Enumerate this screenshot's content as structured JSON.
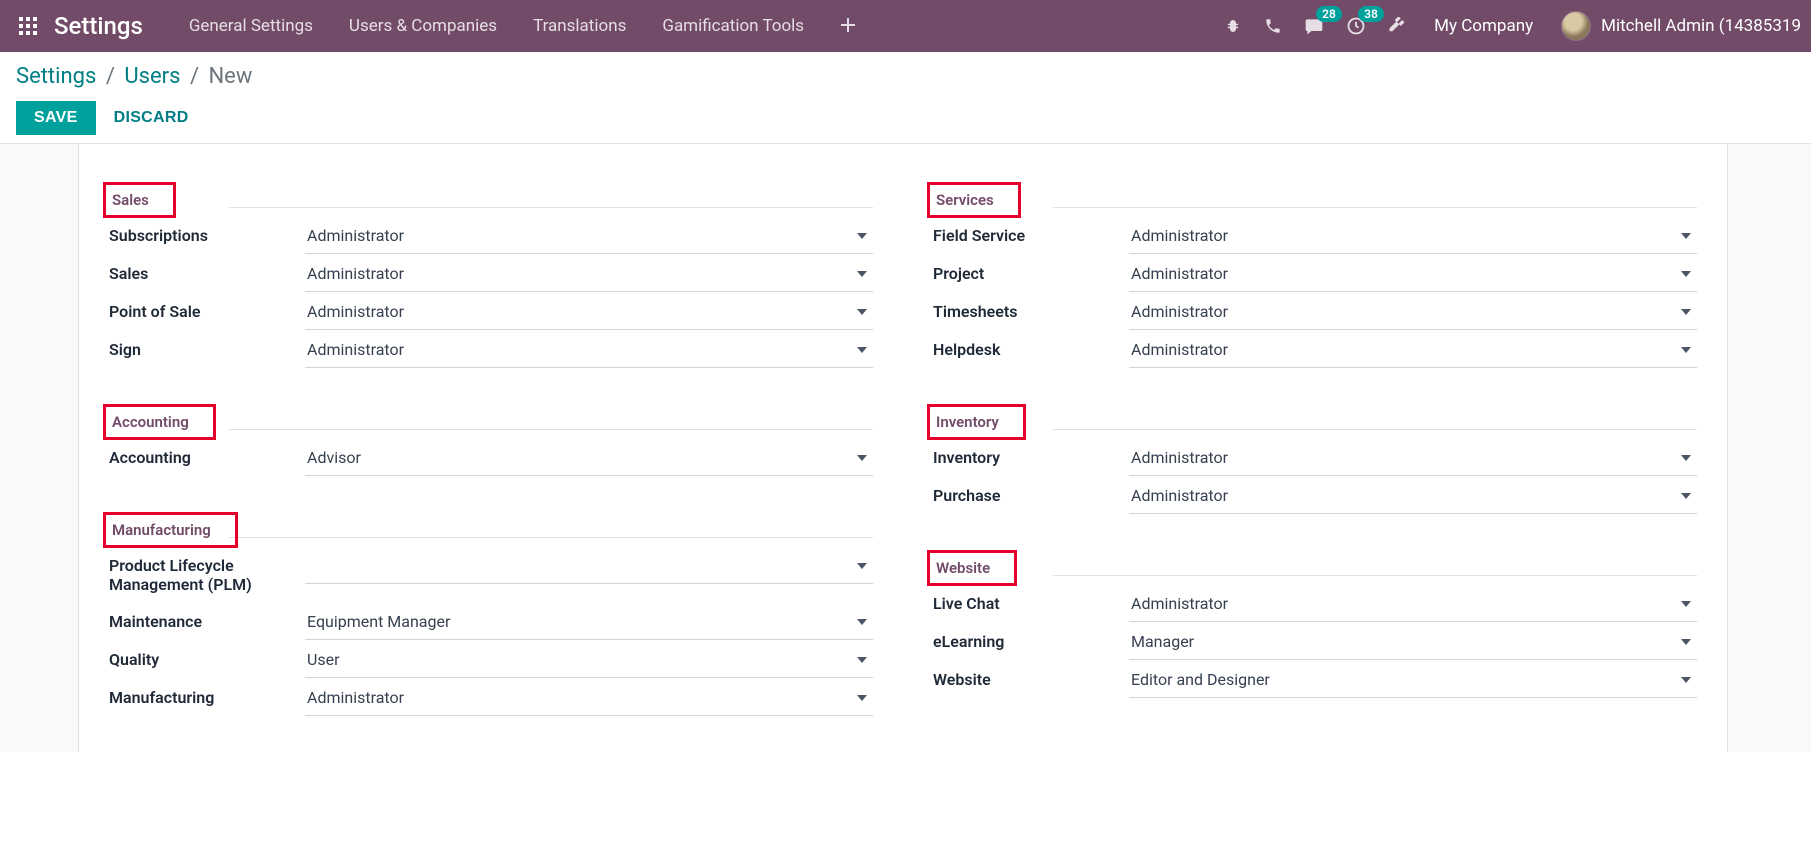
{
  "nav": {
    "brand": "Settings",
    "items": [
      "General Settings",
      "Users & Companies",
      "Translations",
      "Gamification Tools"
    ],
    "messages_badge": "28",
    "activities_badge": "38",
    "company": "My Company",
    "user": "Mitchell Admin (14385319"
  },
  "cp": {
    "crumb1": "Settings",
    "crumb2": "Users",
    "crumb3": "New",
    "save": "SAVE",
    "discard": "DISCARD"
  },
  "left_sections": [
    {
      "title": "Sales",
      "fields": [
        {
          "label": "Subscriptions",
          "value": "Administrator"
        },
        {
          "label": "Sales",
          "value": "Administrator"
        },
        {
          "label": "Point of Sale",
          "value": "Administrator"
        },
        {
          "label": "Sign",
          "value": "Administrator"
        }
      ]
    },
    {
      "title": "Accounting",
      "fields": [
        {
          "label": "Accounting",
          "value": "Advisor"
        }
      ]
    },
    {
      "title": "Manufacturing",
      "fields": [
        {
          "label": "Product Lifecycle Management (PLM)",
          "value": ""
        },
        {
          "label": "Maintenance",
          "value": "Equipment Manager"
        },
        {
          "label": "Quality",
          "value": "User"
        },
        {
          "label": "Manufacturing",
          "value": "Administrator"
        }
      ]
    }
  ],
  "right_sections": [
    {
      "title": "Services",
      "fields": [
        {
          "label": "Field Service",
          "value": "Administrator"
        },
        {
          "label": "Project",
          "value": "Administrator"
        },
        {
          "label": "Timesheets",
          "value": "Administrator"
        },
        {
          "label": "Helpdesk",
          "value": "Administrator"
        }
      ]
    },
    {
      "title": "Inventory",
      "fields": [
        {
          "label": "Inventory",
          "value": "Administrator"
        },
        {
          "label": "Purchase",
          "value": "Administrator"
        }
      ]
    },
    {
      "title": "Website",
      "fields": [
        {
          "label": "Live Chat",
          "value": "Administrator"
        },
        {
          "label": "eLearning",
          "value": "Manager"
        },
        {
          "label": "Website",
          "value": "Editor and Designer"
        }
      ]
    }
  ]
}
